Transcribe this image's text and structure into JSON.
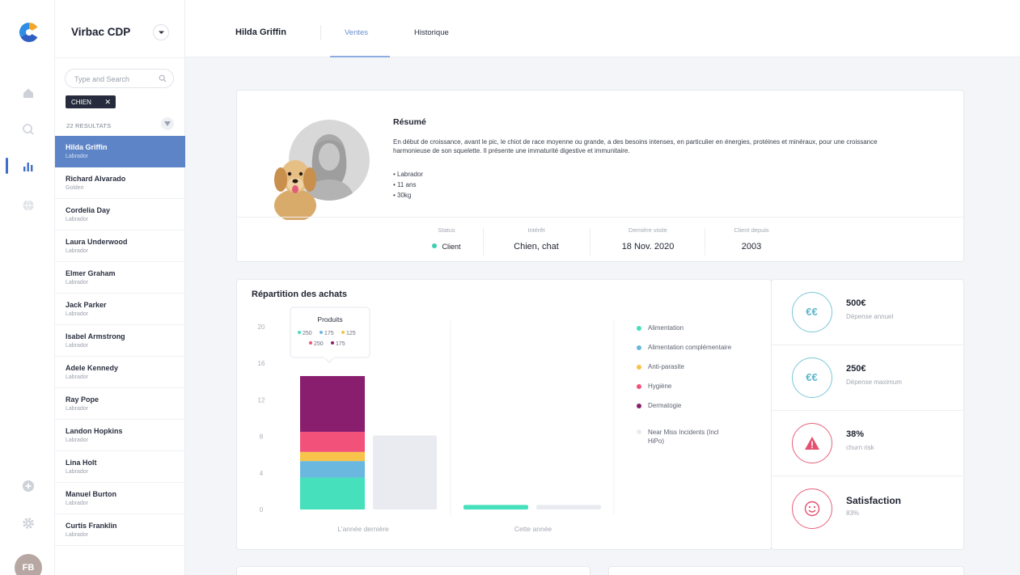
{
  "app": {
    "name": "Virbac CDP"
  },
  "search": {
    "placeholder": "Type and Search"
  },
  "filter_chip": {
    "label": "CHIEN",
    "remove": "✕"
  },
  "results_label": "22 RESULTATS",
  "user_initials": "FB",
  "customers": [
    {
      "name": "Hilda Griffin",
      "breed": "Labrador"
    },
    {
      "name": "Richard Alvarado",
      "breed": "Golden"
    },
    {
      "name": "Cordelia Day",
      "breed": "Labrador"
    },
    {
      "name": "Laura Underwood",
      "breed": "Labrador"
    },
    {
      "name": "Elmer Graham",
      "breed": "Labrador"
    },
    {
      "name": "Jack Parker",
      "breed": "Labrador"
    },
    {
      "name": "Isabel Armstrong",
      "breed": "Labrador"
    },
    {
      "name": "Adele Kennedy",
      "breed": "Labrador"
    },
    {
      "name": "Ray Pope",
      "breed": "Labrador"
    },
    {
      "name": "Landon Hopkins",
      "breed": "Labrador"
    },
    {
      "name": "Lina Holt",
      "breed": "Labrador"
    },
    {
      "name": "Manuel Burton",
      "breed": "Labrador"
    },
    {
      "name": "Curtis Franklin",
      "breed": "Labrador"
    }
  ],
  "header": {
    "customer_name": "Hilda Griffin",
    "tabs": [
      {
        "label": "Ventes",
        "active": true
      },
      {
        "label": "Historique",
        "active": false
      }
    ]
  },
  "summary": {
    "title": "Résumé",
    "text": "En début de croissance, avant le pic, le chiot de race moyenne ou grande, a des besoins intenses, en particulier en énergies, protéines et minéraux, pour une croissance harmonieuse de son squelette. Il présente une immaturité digestive et immunitaire.",
    "bullets": [
      "Labrador",
      "11 ans",
      "30kg"
    ],
    "stats": [
      {
        "label": "Status",
        "value": "Client"
      },
      {
        "label": "Intérêt",
        "value": "Chien, chat"
      },
      {
        "label": "Dernière visite",
        "value": "18 Nov. 2020"
      },
      {
        "label": "Client depuis",
        "value": "2003"
      }
    ]
  },
  "chart_data": {
    "type": "bar",
    "title": "Répartition des achats",
    "categories": [
      "L'année dernière",
      "Cette année"
    ],
    "yticks": [
      0,
      4,
      8,
      12,
      16,
      20
    ],
    "ylim": [
      0,
      20
    ],
    "stacked": true,
    "series": [
      {
        "name": "Alimentation",
        "color": "#46e0bd",
        "values": [
          3.5,
          0.5
        ]
      },
      {
        "name": "Alimentation complémentaire",
        "color": "#6ab8df",
        "values": [
          1.8,
          0
        ]
      },
      {
        "name": "Anti-parasite",
        "color": "#f7c34a",
        "values": [
          1.0,
          0
        ]
      },
      {
        "name": "Hygiène",
        "color": "#f2527a",
        "values": [
          2.2,
          0
        ]
      },
      {
        "name": "Dermatogie",
        "color": "#8a1e6e",
        "values": [
          6.1,
          0
        ]
      }
    ],
    "reference": {
      "name": "Near Miss Incidents (Incl HiPo)",
      "color": "#e9ebf0",
      "values": [
        8.1,
        0.5
      ]
    },
    "tooltip": {
      "title": "Produits",
      "row1": [
        {
          "value": "250",
          "color": "#46e0bd"
        },
        {
          "value": "175",
          "color": "#6ab8df"
        },
        {
          "value": "125",
          "color": "#f7c34a"
        }
      ],
      "row2": [
        {
          "value": "250",
          "color": "#f2527a"
        },
        {
          "value": "175",
          "color": "#8a1e6e"
        }
      ]
    },
    "legend_position": "right"
  },
  "kpis": [
    {
      "value": "500€",
      "label": "Dépense annuel",
      "icon": "euro-icon",
      "glyph": "€€"
    },
    {
      "value": "250€",
      "label": "Dépense maximum",
      "icon": "euro-icon",
      "glyph": "€€"
    },
    {
      "value": "38%",
      "label": "churn risk",
      "icon": "warning-icon"
    },
    {
      "value": "Satisfaction",
      "label": "83%",
      "icon": "smiley-icon"
    }
  ]
}
